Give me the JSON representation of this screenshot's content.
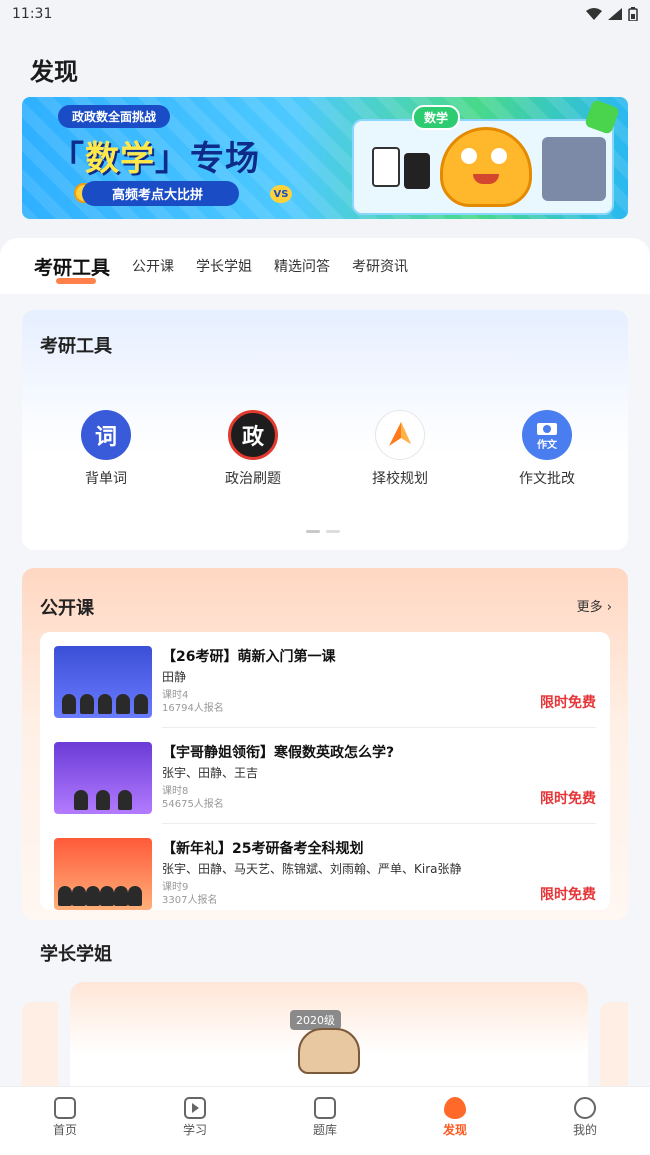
{
  "status": {
    "time": "11:31"
  },
  "page_title": "发现",
  "banner": {
    "top_pill": "政政数全面挑战",
    "headline_pre": "「",
    "headline_hl": "数学",
    "headline_post": "」专场",
    "bottom_pill": "高频考点大比拼",
    "vs": "VS",
    "math_tag": "数学"
  },
  "tabs": [
    {
      "label": "考研工具",
      "active": true
    },
    {
      "label": "公开课"
    },
    {
      "label": "学长学姐"
    },
    {
      "label": "精选问答"
    },
    {
      "label": "考研资讯"
    }
  ],
  "tools": {
    "title": "考研工具",
    "items": [
      {
        "label": "背单词",
        "glyph": "词",
        "color": "#3a5bd9"
      },
      {
        "label": "政治刷题",
        "glyph": "政",
        "color": "#1d1d1d"
      },
      {
        "label": "择校规划",
        "glyph": "",
        "color": "#ffffff"
      },
      {
        "label": "作文批改",
        "glyph": "作文",
        "color": "#4a7df0"
      }
    ]
  },
  "courses": {
    "title": "公开课",
    "more": "更多 ›",
    "items": [
      {
        "title": "【26考研】萌新入门第一课",
        "teachers": "田静",
        "lessons": "课时4",
        "signups": "16794人报名",
        "badge": "限时免费"
      },
      {
        "title": "【宇哥静姐领衔】寒假数英政怎么学?",
        "teachers": "张宇、田静、王吉",
        "lessons": "课时8",
        "signups": "54675人报名",
        "badge": "限时免费"
      },
      {
        "title": "【新年礼】25考研备考全科规划",
        "teachers": "张宇、田静、马天艺、陈锦斌、刘雨翰、严单、Kira张静",
        "lessons": "课时9",
        "signups": "3307人报名",
        "badge": "限时免费"
      }
    ]
  },
  "seniors": {
    "title": "学长学姐",
    "year_badge": "2020级"
  },
  "bottom_nav": [
    {
      "label": "首页",
      "icon": "home-icon"
    },
    {
      "label": "学习",
      "icon": "play-icon"
    },
    {
      "label": "题库",
      "icon": "question-bank-icon"
    },
    {
      "label": "发现",
      "icon": "discover-icon",
      "active": true
    },
    {
      "label": "我的",
      "icon": "profile-icon"
    }
  ]
}
